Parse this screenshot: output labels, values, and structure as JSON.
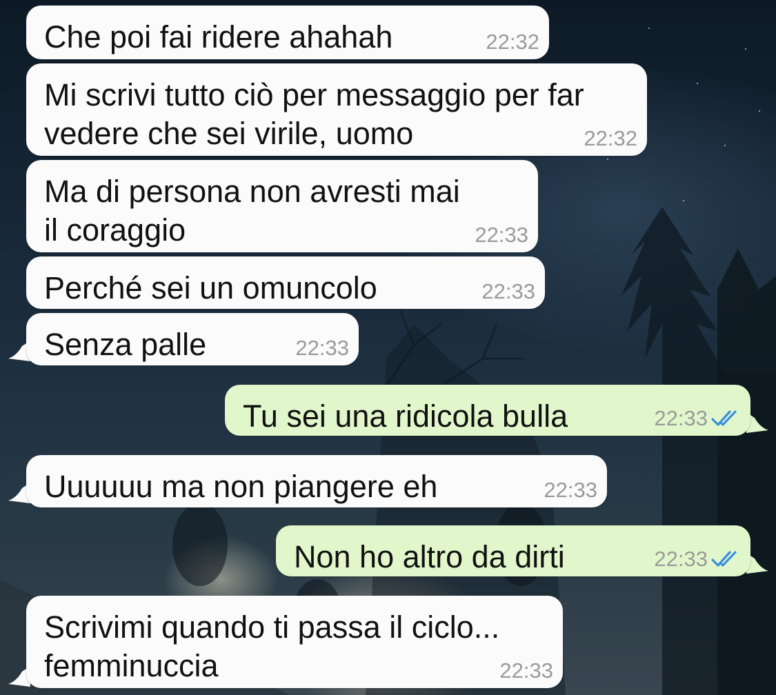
{
  "messages": [
    {
      "direction": "in",
      "text": "Che poi fai ridere ahahah",
      "time": "22:32"
    },
    {
      "direction": "in",
      "text": "Mi scrivi tutto ciò per messaggio per far\nvedere che sei virile, uomo",
      "time": "22:32"
    },
    {
      "direction": "in",
      "text": "Ma di persona non avresti mai\nil coraggio",
      "time": "22:33"
    },
    {
      "direction": "in",
      "text": "Perché sei un omuncolo",
      "time": "22:33"
    },
    {
      "direction": "in",
      "text": "Senza palle",
      "time": "22:33"
    },
    {
      "direction": "out",
      "text": "Tu sei una ridicola bulla",
      "time": "22:33",
      "status": "read"
    },
    {
      "direction": "in",
      "text": "Uuuuuu ma non piangere eh",
      "time": "22:33"
    },
    {
      "direction": "out",
      "text": "Non ho altro da dirti",
      "time": "22:33",
      "status": "read"
    },
    {
      "direction": "in",
      "text": "Scrivimi quando ti passa il ciclo...\nfemminuccia",
      "time": "22:33"
    }
  ],
  "colors": {
    "incoming_bubble": "#fbfbfb",
    "outgoing_bubble": "#e1f7cb",
    "timestamp": "#9a9a9a",
    "read_ticks": "#3b8ee0"
  },
  "icons": {
    "read_status": "double-check-icon"
  }
}
